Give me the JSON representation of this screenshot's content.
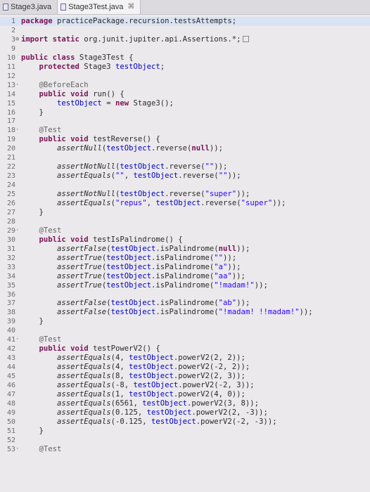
{
  "tabs": [
    {
      "label": "Stage3.java",
      "active": false,
      "closable": false
    },
    {
      "label": "Stage3Test.java",
      "active": true,
      "closable": true
    }
  ],
  "close_glyph": "⌘",
  "lines": [
    {
      "n": "1",
      "fold": "",
      "hl": true,
      "segs": [
        [
          "kw",
          "package"
        ],
        [
          "",
          "practicePackage.recursion.testsAttempts;"
        ]
      ]
    },
    {
      "n": "2",
      "fold": "",
      "segs": []
    },
    {
      "n": "3",
      "fold": "+",
      "segs": [
        [
          "kw",
          "import static"
        ],
        [
          "",
          "org.junit.jupiter.api.Assertions.*;"
        ],
        [
          "box",
          ""
        ]
      ]
    },
    {
      "n": "9",
      "fold": "",
      "segs": []
    },
    {
      "n": "10",
      "fold": "",
      "segs": [
        [
          "kw",
          "public class"
        ],
        [
          "",
          "Stage3Test {"
        ]
      ]
    },
    {
      "n": "11",
      "fold": "",
      "segs": [
        [
          "",
          "    "
        ],
        [
          "kw",
          "protected"
        ],
        [
          "",
          "Stage3 "
        ],
        [
          "fld",
          "testObject"
        ],
        [
          "",
          ";"
        ]
      ]
    },
    {
      "n": "12",
      "fold": "",
      "segs": []
    },
    {
      "n": "13",
      "fold": "-",
      "segs": [
        [
          "",
          "    "
        ],
        [
          "ann",
          "@BeforeEach"
        ]
      ]
    },
    {
      "n": "14",
      "fold": "",
      "segs": [
        [
          "",
          "    "
        ],
        [
          "kw",
          "public void"
        ],
        [
          "",
          "run() {"
        ]
      ]
    },
    {
      "n": "15",
      "fold": "",
      "segs": [
        [
          "",
          "        "
        ],
        [
          "fld",
          "testObject"
        ],
        [
          "",
          " = "
        ],
        [
          "kw",
          "new"
        ],
        [
          "",
          "Stage3();"
        ]
      ]
    },
    {
      "n": "16",
      "fold": "",
      "segs": [
        [
          "",
          "    }"
        ]
      ]
    },
    {
      "n": "17",
      "fold": "",
      "segs": []
    },
    {
      "n": "18",
      "fold": "-",
      "segs": [
        [
          "",
          "    "
        ],
        [
          "ann",
          "@Test"
        ]
      ]
    },
    {
      "n": "19",
      "fold": "",
      "segs": [
        [
          "",
          "    "
        ],
        [
          "kw",
          "public void"
        ],
        [
          "",
          "testReverse() {"
        ]
      ]
    },
    {
      "n": "20",
      "fold": "",
      "segs": [
        [
          "",
          "        "
        ],
        [
          "it",
          "assertNull"
        ],
        [
          "",
          "("
        ],
        [
          "fld",
          "testObject"
        ],
        [
          "",
          ".reverse("
        ],
        [
          "kw",
          "null"
        ],
        [
          "",
          "));"
        ]
      ]
    },
    {
      "n": "21",
      "fold": "",
      "segs": []
    },
    {
      "n": "22",
      "fold": "",
      "segs": [
        [
          "",
          "        "
        ],
        [
          "it",
          "assertNotNull"
        ],
        [
          "",
          "("
        ],
        [
          "fld",
          "testObject"
        ],
        [
          "",
          ".reverse("
        ],
        [
          "str",
          "\"\""
        ],
        [
          "",
          "));"
        ]
      ]
    },
    {
      "n": "23",
      "fold": "",
      "segs": [
        [
          "",
          "        "
        ],
        [
          "it",
          "assertEquals"
        ],
        [
          "",
          "("
        ],
        [
          "str",
          "\"\""
        ],
        [
          "",
          ", "
        ],
        [
          "fld",
          "testObject"
        ],
        [
          "",
          ".reverse("
        ],
        [
          "str",
          "\"\""
        ],
        [
          "",
          "));"
        ]
      ]
    },
    {
      "n": "24",
      "fold": "",
      "segs": []
    },
    {
      "n": "25",
      "fold": "",
      "segs": [
        [
          "",
          "        "
        ],
        [
          "it",
          "assertNotNull"
        ],
        [
          "",
          "("
        ],
        [
          "fld",
          "testObject"
        ],
        [
          "",
          ".reverse("
        ],
        [
          "str",
          "\"super\""
        ],
        [
          "",
          "));"
        ]
      ]
    },
    {
      "n": "26",
      "fold": "",
      "segs": [
        [
          "",
          "        "
        ],
        [
          "it",
          "assertEquals"
        ],
        [
          "",
          "("
        ],
        [
          "str",
          "\"repus\""
        ],
        [
          "",
          ", "
        ],
        [
          "fld",
          "testObject"
        ],
        [
          "",
          ".reverse("
        ],
        [
          "str",
          "\"super\""
        ],
        [
          "",
          "));"
        ]
      ]
    },
    {
      "n": "27",
      "fold": "",
      "segs": [
        [
          "",
          "    }"
        ]
      ]
    },
    {
      "n": "28",
      "fold": "",
      "segs": []
    },
    {
      "n": "29",
      "fold": "-",
      "segs": [
        [
          "",
          "    "
        ],
        [
          "ann",
          "@Test"
        ]
      ]
    },
    {
      "n": "30",
      "fold": "",
      "segs": [
        [
          "",
          "    "
        ],
        [
          "kw",
          "public void"
        ],
        [
          "",
          "testIsPalindrome() {"
        ]
      ]
    },
    {
      "n": "31",
      "fold": "",
      "segs": [
        [
          "",
          "        "
        ],
        [
          "it",
          "assertFalse"
        ],
        [
          "",
          "("
        ],
        [
          "fld",
          "testObject"
        ],
        [
          "",
          ".isPalindrome("
        ],
        [
          "kw",
          "null"
        ],
        [
          "",
          "));"
        ]
      ]
    },
    {
      "n": "32",
      "fold": "",
      "segs": [
        [
          "",
          "        "
        ],
        [
          "it",
          "assertTrue"
        ],
        [
          "",
          "("
        ],
        [
          "fld",
          "testObject"
        ],
        [
          "",
          ".isPalindrome("
        ],
        [
          "str",
          "\"\""
        ],
        [
          "",
          "));"
        ]
      ]
    },
    {
      "n": "33",
      "fold": "",
      "segs": [
        [
          "",
          "        "
        ],
        [
          "it",
          "assertTrue"
        ],
        [
          "",
          "("
        ],
        [
          "fld",
          "testObject"
        ],
        [
          "",
          ".isPalindrome("
        ],
        [
          "str",
          "\"a\""
        ],
        [
          "",
          "));"
        ]
      ]
    },
    {
      "n": "34",
      "fold": "",
      "segs": [
        [
          "",
          "        "
        ],
        [
          "it",
          "assertTrue"
        ],
        [
          "",
          "("
        ],
        [
          "fld",
          "testObject"
        ],
        [
          "",
          ".isPalindrome("
        ],
        [
          "str",
          "\"aa\""
        ],
        [
          "",
          "));"
        ]
      ]
    },
    {
      "n": "35",
      "fold": "",
      "segs": [
        [
          "",
          "        "
        ],
        [
          "it",
          "assertTrue"
        ],
        [
          "",
          "("
        ],
        [
          "fld",
          "testObject"
        ],
        [
          "",
          ".isPalindrome("
        ],
        [
          "str",
          "\"!madam!\""
        ],
        [
          "",
          "));"
        ]
      ]
    },
    {
      "n": "36",
      "fold": "",
      "segs": []
    },
    {
      "n": "37",
      "fold": "",
      "segs": [
        [
          "",
          "        "
        ],
        [
          "it",
          "assertFalse"
        ],
        [
          "",
          "("
        ],
        [
          "fld",
          "testObject"
        ],
        [
          "",
          ".isPalindrome("
        ],
        [
          "str",
          "\"ab\""
        ],
        [
          "",
          "));"
        ]
      ]
    },
    {
      "n": "38",
      "fold": "",
      "segs": [
        [
          "",
          "        "
        ],
        [
          "it",
          "assertFalse"
        ],
        [
          "",
          "("
        ],
        [
          "fld",
          "testObject"
        ],
        [
          "",
          ".isPalindrome("
        ],
        [
          "str",
          "\"!madam! !!madam!\""
        ],
        [
          "",
          "));"
        ]
      ]
    },
    {
      "n": "39",
      "fold": "",
      "segs": [
        [
          "",
          "    }"
        ]
      ]
    },
    {
      "n": "40",
      "fold": "",
      "segs": []
    },
    {
      "n": "41",
      "fold": "-",
      "segs": [
        [
          "",
          "    "
        ],
        [
          "ann",
          "@Test"
        ]
      ]
    },
    {
      "n": "42",
      "fold": "",
      "segs": [
        [
          "",
          "    "
        ],
        [
          "kw",
          "public void"
        ],
        [
          "",
          "testPowerV2() {"
        ]
      ]
    },
    {
      "n": "43",
      "fold": "",
      "segs": [
        [
          "",
          "        "
        ],
        [
          "it",
          "assertEquals"
        ],
        [
          "",
          "(4, "
        ],
        [
          "fld",
          "testObject"
        ],
        [
          "",
          ".powerV2(2, 2));"
        ]
      ]
    },
    {
      "n": "44",
      "fold": "",
      "segs": [
        [
          "",
          "        "
        ],
        [
          "it",
          "assertEquals"
        ],
        [
          "",
          "(4, "
        ],
        [
          "fld",
          "testObject"
        ],
        [
          "",
          ".powerV2(-2, 2));"
        ]
      ]
    },
    {
      "n": "45",
      "fold": "",
      "segs": [
        [
          "",
          "        "
        ],
        [
          "it",
          "assertEquals"
        ],
        [
          "",
          "(8, "
        ],
        [
          "fld",
          "testObject"
        ],
        [
          "",
          ".powerV2(2, 3));"
        ]
      ]
    },
    {
      "n": "46",
      "fold": "",
      "segs": [
        [
          "",
          "        "
        ],
        [
          "it",
          "assertEquals"
        ],
        [
          "",
          "(-8, "
        ],
        [
          "fld",
          "testObject"
        ],
        [
          "",
          ".powerV2(-2, 3));"
        ]
      ]
    },
    {
      "n": "47",
      "fold": "",
      "segs": [
        [
          "",
          "        "
        ],
        [
          "it",
          "assertEquals"
        ],
        [
          "",
          "(1, "
        ],
        [
          "fld",
          "testObject"
        ],
        [
          "",
          ".powerV2(4, 0));"
        ]
      ]
    },
    {
      "n": "48",
      "fold": "",
      "segs": [
        [
          "",
          "        "
        ],
        [
          "it",
          "assertEquals"
        ],
        [
          "",
          "(6561, "
        ],
        [
          "fld",
          "testObject"
        ],
        [
          "",
          ".powerV2(3, 8));"
        ]
      ]
    },
    {
      "n": "49",
      "fold": "",
      "segs": [
        [
          "",
          "        "
        ],
        [
          "it",
          "assertEquals"
        ],
        [
          "",
          "(0.125, "
        ],
        [
          "fld",
          "testObject"
        ],
        [
          "",
          ".powerV2(2, -3));"
        ]
      ]
    },
    {
      "n": "50",
      "fold": "",
      "segs": [
        [
          "",
          "        "
        ],
        [
          "it",
          "assertEquals"
        ],
        [
          "",
          "(-0.125, "
        ],
        [
          "fld",
          "testObject"
        ],
        [
          "",
          ".powerV2(-2, -3));"
        ]
      ]
    },
    {
      "n": "51",
      "fold": "",
      "segs": [
        [
          "",
          "    }"
        ]
      ]
    },
    {
      "n": "52",
      "fold": "",
      "segs": []
    },
    {
      "n": "53",
      "fold": "-",
      "segs": [
        [
          "",
          "    "
        ],
        [
          "ann",
          "@Test"
        ]
      ]
    }
  ]
}
